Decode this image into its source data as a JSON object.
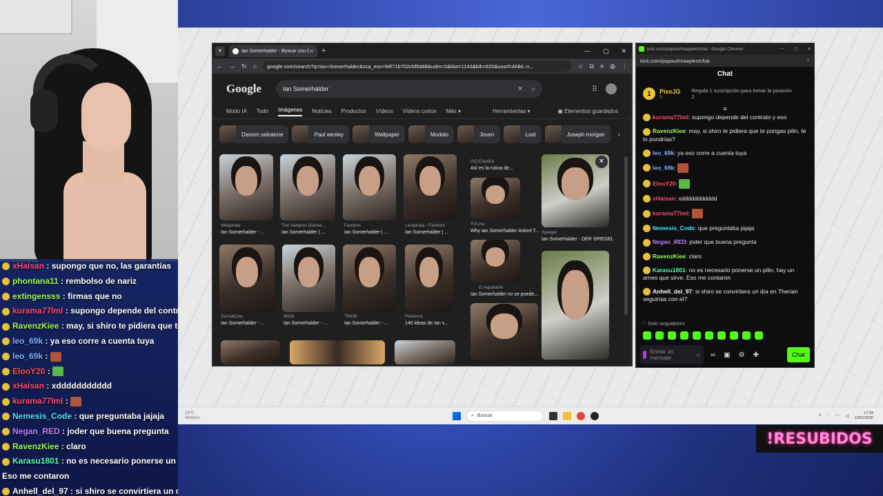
{
  "colors": {
    "kick_green": "#53fc18",
    "resubidos_pink": "#ff8ad8"
  },
  "browser": {
    "tab_title": "Ian Somerhalder - Buscar con G",
    "url": "google.com/search?q=Ian+Somerhalder&sca_esv=94f71b702cfd5d48&udm=2&biw=1143&bih=820&sxsrf=ANbL-n...",
    "logo": "Google",
    "query": "Ian Somerhalder",
    "tabs": [
      "Modo IA",
      "Todo",
      "Imágenes",
      "Noticias",
      "Productos",
      "Vídeos",
      "Vídeos cortos",
      "Más"
    ],
    "herramientas": "Herramientas",
    "guardados": "Elementos guardados",
    "chips": [
      "Damon salvatore",
      "Paul wesley",
      "Wallpaper",
      "Modelo",
      "Joven",
      "Lost",
      "Joseph morgan"
    ],
    "results": [
      {
        "src": "Wikipedia",
        "title": "Ian Somerhalder - ..."
      },
      {
        "src": "The Vampire Diaries...",
        "title": "Ian Somerhalder | ..."
      },
      {
        "src": "Fandom",
        "title": "Ian Somerhalder | ..."
      },
      {
        "src": "Lostpedia - Fandom",
        "title": "Ian Somerhalder | ..."
      },
      {
        "src": "GQ España",
        "title": "Así es la rutina de..."
      },
      {
        "src": "TVLine",
        "title": "Why Ian Somerhalder Asked T..."
      },
      {
        "src": "Spiegel",
        "title": "Ian Somerhalder - DER SPIEGEL"
      },
      {
        "src": "SensaCine",
        "title": "Ian Somerhalder - ..."
      },
      {
        "src": "IMDb",
        "title": "Ian Somerhalder - ..."
      },
      {
        "src": "TMDB",
        "title": "Ian Somerhalder - ..."
      },
      {
        "src": "Pinterest",
        "title": "140 ideas de Ian s..."
      },
      {
        "src": "El Aquelarre",
        "title": "Ian Somerhalder no se puede..."
      }
    ]
  },
  "kick": {
    "window_title": "kick.com/popout/maaylen/chat - Google Chrome",
    "url": "kick.com/popout/maaylen/chat",
    "header": "Chat",
    "pinned": {
      "num": "1",
      "user": "PieeJG",
      "count": "5",
      "msg": "Regala 1 suscripción para tomar la posición 2"
    },
    "messages": [
      {
        "user": "kurama77lml",
        "color": "#ff4b6e",
        "text": "supongo depende del contrato y eso"
      },
      {
        "user": "RavenzKiee",
        "color": "#9cff57",
        "text": "may, si shiro te pidiera que te pongas pilin, te lo pondrías?"
      },
      {
        "user": "leo_69k",
        "color": "#7fb3ff",
        "text": "ya eso corre a cuenta tuya"
      },
      {
        "user": "leo_69k",
        "color": "#7fb3ff",
        "text": ""
      },
      {
        "user": "ElooY20",
        "color": "#ff5050",
        "text": ""
      },
      {
        "user": "xHaisan",
        "color": "#ff4b6e",
        "text": "xddddddddddd"
      },
      {
        "user": "kurama77lml",
        "color": "#ff4b6e",
        "text": ""
      },
      {
        "user": "Nemesis_Code",
        "color": "#57e0ff",
        "text": "que preguntaba jajaja"
      },
      {
        "user": "Negan_RED",
        "color": "#c080ff",
        "text": "joder que buena pregunta"
      },
      {
        "user": "RavenzKiee",
        "color": "#9cff57",
        "text": "claro"
      },
      {
        "user": "Karasu1801",
        "color": "#57ffb0",
        "text": "no es necesario ponerse un pilin, hay un arnes que sirve. Eso me contaron"
      },
      {
        "user": "Anhell_del_97",
        "color": "#ffffff",
        "text": "si shiro se convirtiera un día en Therian seguirías con el?"
      }
    ],
    "followers_only": "Solo seguidores",
    "input_placeholder": "Enviar un mensaje",
    "send": "Chat"
  },
  "left_chat": [
    {
      "user": "xHaisan",
      "color": "#ff4b6e",
      "text": "supongo que no, las garantías"
    },
    {
      "user": "phontana11",
      "color": "#9cff57",
      "text": "rembolso de nariz"
    },
    {
      "user": "extingensss",
      "color": "#9cff57",
      "text": "firmas que no"
    },
    {
      "user": "kurama77lml",
      "color": "#ff4b6e",
      "text": "supongo depende del contrat"
    },
    {
      "user": "RavenzKiee",
      "color": "#9cff57",
      "text": "may, si shiro te pidiera que te p"
    },
    {
      "user": "leo_69k",
      "color": "#7fb3ff",
      "text": "ya eso corre a cuenta tuya"
    },
    {
      "user": "leo_69k",
      "color": "#7fb3ff",
      "text": ""
    },
    {
      "user": "ElooY20",
      "color": "#ff5050",
      "text": ""
    },
    {
      "user": "xHaisan",
      "color": "#ff4b6e",
      "text": "xddddddddddd"
    },
    {
      "user": "kurama77lml",
      "color": "#ff4b6e",
      "text": ""
    },
    {
      "user": "Nemesis_Code",
      "color": "#57e0ff",
      "text": "que preguntaba jajaja"
    },
    {
      "user": "Negan_RED",
      "color": "#c080ff",
      "text": "joder que buena pregunta"
    },
    {
      "user": "RavenzKiee",
      "color": "#9cff57",
      "text": "claro"
    },
    {
      "user": "Karasu1801",
      "color": "#57ffb0",
      "text": "no es necesario ponerse un p"
    },
    {
      "user": "",
      "color": "#ffffff",
      "text": "Eso me contaron"
    },
    {
      "user": "Anhell_del_97",
      "color": "#ffffff",
      "text": "si shiro se convirtiera un día en"
    }
  ],
  "taskbar": {
    "weather_temp": "13°C",
    "weather_desc": "Ventoso",
    "search": "Buscar",
    "time": "17:34",
    "date": "13/02/2026"
  },
  "overlay_label": "!RESUBIDOS"
}
